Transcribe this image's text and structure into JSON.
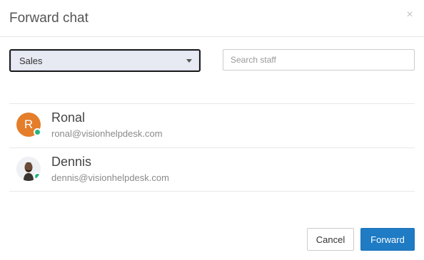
{
  "dialog": {
    "title": "Forward chat",
    "close_glyph": "×"
  },
  "department_select": {
    "selected": "Sales",
    "icon": "caret-down-icon"
  },
  "search": {
    "value": "",
    "placeholder": "Search staff"
  },
  "staff": [
    {
      "name": "Ronal",
      "email": "ronal@visionhelpdesk.com",
      "avatar_type": "initial",
      "avatar_initial": "R",
      "avatar_color": "#e47e2a",
      "status": "online",
      "status_color": "#26b67c"
    },
    {
      "name": "Dennis",
      "email": "dennis@visionhelpdesk.com",
      "avatar_type": "photo",
      "status": "online",
      "status_color": "#26b67c"
    }
  ],
  "actions": {
    "cancel_label": "Cancel",
    "forward_label": "Forward",
    "forward_color": "#1e7bc4"
  }
}
